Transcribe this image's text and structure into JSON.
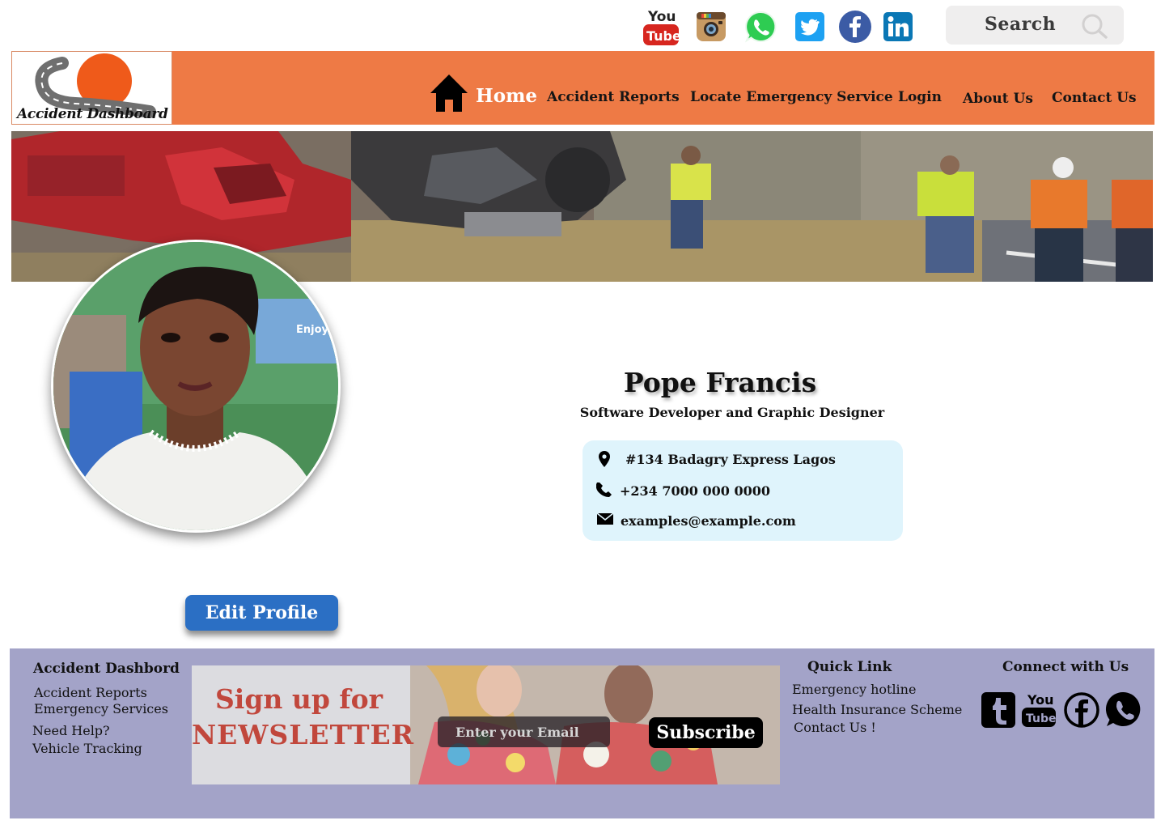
{
  "social_bar": {
    "icons": [
      "youtube-icon",
      "instagram-icon",
      "whatsapp-icon",
      "twitter-icon",
      "facebook-icon",
      "linkedin-icon"
    ],
    "youtube_top": "You",
    "youtube_bottom": "Tube",
    "search_label": "Search"
  },
  "header": {
    "logo_text": "Accident Dashboard",
    "nav": {
      "home": "Home",
      "reports": "Accident Reports",
      "locate": "Locate Emergency Service",
      "login": "Login",
      "about": "About Us",
      "contact": "Contact Us"
    }
  },
  "profile": {
    "name": "Pope Francis",
    "role": "Software Developer and Graphic Designer",
    "address": "#134 Badagry Express Lagos",
    "phone": "+234 7000 000 0000",
    "email": "examples@example.com",
    "edit_label": "Edit Profile",
    "avatar_sign_text": "Enjoy"
  },
  "footer": {
    "brand_heading": "Accident Dashbord",
    "links": [
      "Accident Reports",
      "Emergency Services",
      "Need Help?",
      "Vehicle Tracking"
    ],
    "newsletter": {
      "line1": "Sign up for",
      "line2": "NEWSLETTER",
      "email_placeholder": "Enter your Email",
      "subscribe_label": "Subscribe"
    },
    "quick_link_heading": "Quick Link",
    "quick_links": [
      "Emergency hotline",
      "Health Insurance Scheme",
      "Contact Us !"
    ],
    "connect_heading": "Connect with Us",
    "connect_icons": [
      "tumblr-icon",
      "youtube-icon",
      "facebook-icon",
      "whatsapp-icon"
    ],
    "connect_youtube_top": "You",
    "connect_youtube_bottom": "Tube"
  },
  "colors": {
    "nav_bg": "#ee7a45",
    "footer_bg": "#a3a3c8",
    "info_card_bg": "#dff4fc",
    "edit_button": "#2b6fc4",
    "newsletter_title": "#c1473c"
  }
}
